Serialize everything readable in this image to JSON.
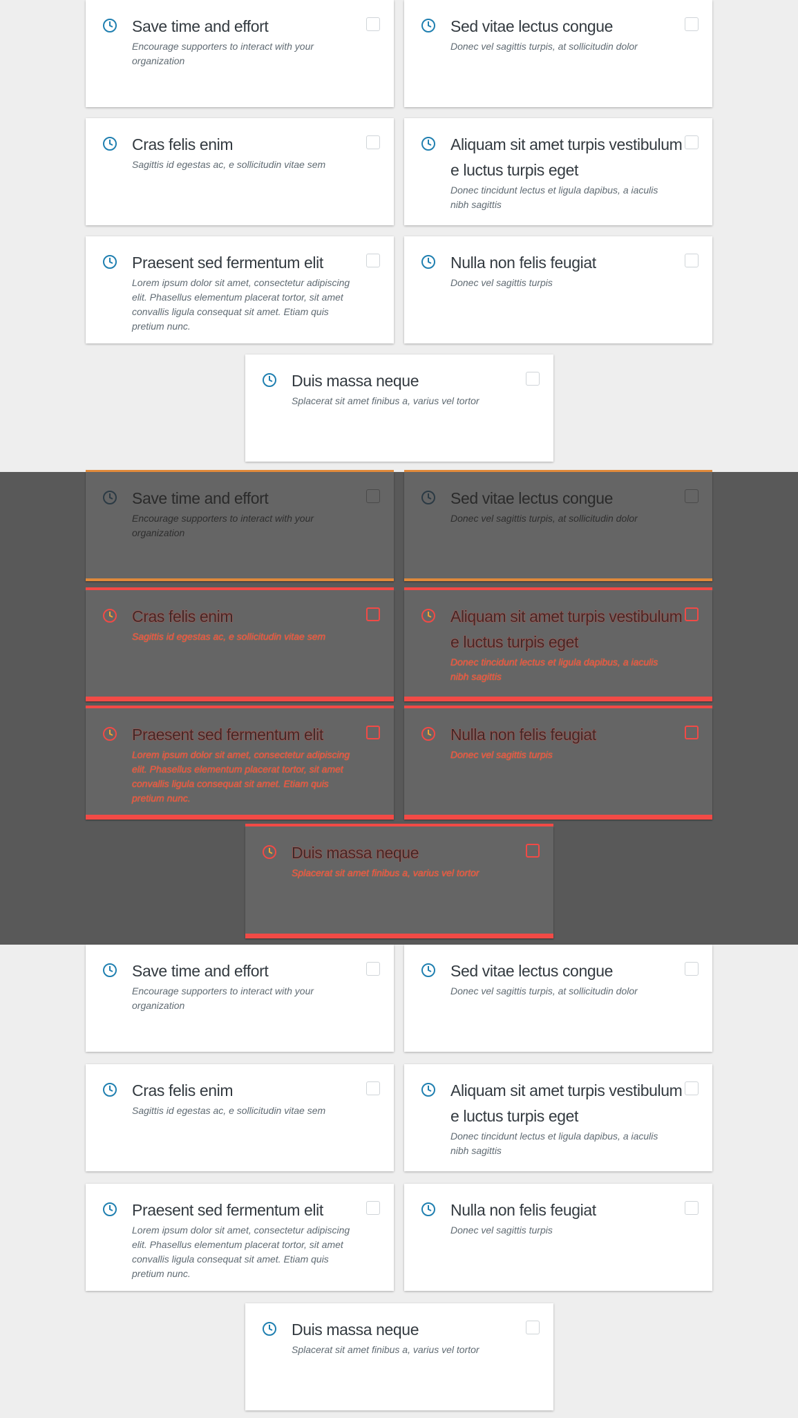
{
  "accent_color": "#1f7fb0",
  "highlight_color": "#f24a46",
  "icon": "clock-icon",
  "sections": [
    {
      "variant": "normal",
      "cards": [
        {
          "title": "Save time and effort",
          "description": "Encourage supporters to interact with your organization"
        },
        {
          "title": "Sed vitae lectus congue",
          "description": "Donec vel sagittis turpis, at sollicitudin dolor"
        },
        {
          "title": "Cras felis enim",
          "description": "Sagittis id egestas ac, e sollicitudin vitae sem"
        },
        {
          "title": "Aliquam sit amet turpis vestibulum e luctus turpis eget",
          "description": "Donec tincidunt lectus et ligula dapibus, a iaculis nibh sagittis"
        },
        {
          "title": "Praesent sed fermentum elit",
          "description": "Lorem ipsum dolor sit amet, consectetur adipiscing elit. Phasellus elementum placerat tortor, sit amet convallis ligula consequat sit amet. Etiam quis pretium nunc."
        },
        {
          "title": "Nulla non felis feugiat",
          "description": "Donec vel sagittis turpis"
        },
        {
          "title": "Duis massa neque",
          "description": "Splacerat sit amet finibus a, varius vel tortor"
        }
      ]
    },
    {
      "variant": "overlay",
      "cards": [
        {
          "title": "Save time and effort",
          "description": "Encourage supporters to interact with your organization"
        },
        {
          "title": "Sed vitae lectus congue",
          "description": "Donec vel sagittis turpis, at sollicitudin dolor"
        },
        {
          "title": "Cras felis enim",
          "description": "Sagittis id egestas ac, e sollicitudin vitae sem"
        },
        {
          "title": "Aliquam sit amet turpis vestibulum e luctus turpis eget",
          "description": "Donec tincidunt lectus et ligula dapibus, a iaculis nibh sagittis"
        },
        {
          "title": "Praesent sed fermentum elit",
          "description": "Lorem ipsum dolor sit amet, consectetur adipiscing elit. Phasellus elementum placerat tortor, sit amet convallis ligula consequat sit amet. Etiam quis pretium nunc."
        },
        {
          "title": "Nulla non felis feugiat",
          "description": "Donec vel sagittis turpis"
        },
        {
          "title": "Duis massa neque",
          "description": "Splacerat sit amet finibus a, varius vel tortor"
        }
      ]
    },
    {
      "variant": "normal",
      "cards": [
        {
          "title": "Save time and effort",
          "description": "Encourage supporters to interact with your organization"
        },
        {
          "title": "Sed vitae lectus congue",
          "description": "Donec vel sagittis turpis, at sollicitudin dolor"
        },
        {
          "title": "Cras felis enim",
          "description": "Sagittis id egestas ac, e sollicitudin vitae sem"
        },
        {
          "title": "Aliquam sit amet turpis vestibulum e luctus turpis eget",
          "description": "Donec tincidunt lectus et ligula dapibus, a iaculis nibh sagittis"
        },
        {
          "title": "Praesent sed fermentum elit",
          "description": "Lorem ipsum dolor sit amet, consectetur adipiscing elit. Phasellus elementum placerat tortor, sit amet convallis ligula consequat sit amet. Etiam quis pretium nunc."
        },
        {
          "title": "Nulla non felis feugiat",
          "description": "Donec vel sagittis turpis"
        },
        {
          "title": "Duis massa neque",
          "description": "Splacerat sit amet finibus a, varius vel tortor"
        }
      ]
    }
  ]
}
